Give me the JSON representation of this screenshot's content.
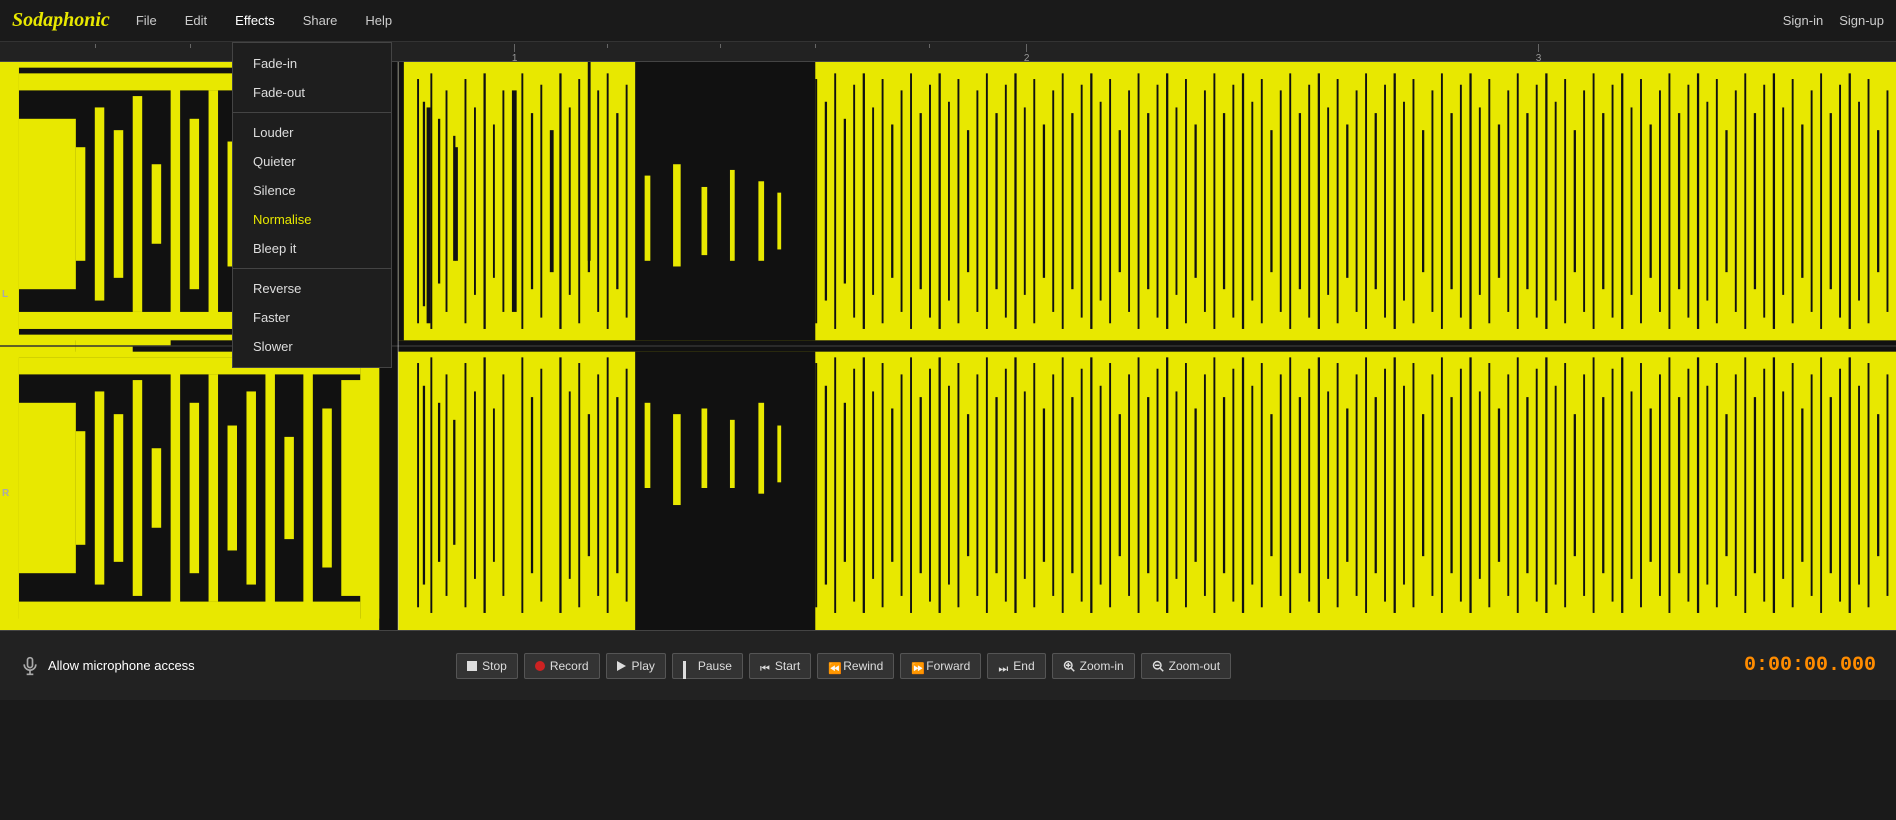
{
  "app": {
    "name": "Sodaphonic",
    "name_part1": "Soda",
    "name_part2": "phonic"
  },
  "nav": {
    "items": [
      {
        "id": "file",
        "label": "File"
      },
      {
        "id": "edit",
        "label": "Edit"
      },
      {
        "id": "effects",
        "label": "Effects"
      },
      {
        "id": "share",
        "label": "Share"
      },
      {
        "id": "help",
        "label": "Help"
      }
    ],
    "right_items": [
      {
        "id": "signin",
        "label": "Sign-in"
      },
      {
        "id": "signup",
        "label": "Sign-up"
      }
    ]
  },
  "effects_menu": {
    "items": [
      {
        "id": "fade-in",
        "label": "Fade-in",
        "highlighted": false,
        "divider_after": false
      },
      {
        "id": "fade-out",
        "label": "Fade-out",
        "highlighted": false,
        "divider_after": true
      },
      {
        "id": "louder",
        "label": "Louder",
        "highlighted": false,
        "divider_after": false
      },
      {
        "id": "quieter",
        "label": "Quieter",
        "highlighted": false,
        "divider_after": false
      },
      {
        "id": "silence",
        "label": "Silence",
        "highlighted": false,
        "divider_after": false
      },
      {
        "id": "normalise",
        "label": "Normalise",
        "highlighted": true,
        "divider_after": false
      },
      {
        "id": "bleep-it",
        "label": "Bleep it",
        "highlighted": false,
        "divider_after": true
      },
      {
        "id": "reverse",
        "label": "Reverse",
        "highlighted": false,
        "divider_after": false
      },
      {
        "id": "faster",
        "label": "Faster",
        "highlighted": false,
        "divider_after": false
      },
      {
        "id": "slower",
        "label": "Slower",
        "highlighted": false,
        "divider_after": false
      }
    ]
  },
  "waveform": {
    "channel_l_label": "L",
    "channel_r_label": "R",
    "timeline_marks": [
      {
        "position_pct": 27,
        "label": "1"
      },
      {
        "position_pct": 54,
        "label": "2"
      },
      {
        "position_pct": 81,
        "label": "3"
      }
    ]
  },
  "toolbar": {
    "mic_label": "Allow microphone access",
    "buttons": [
      {
        "id": "stop",
        "label": "Stop",
        "icon": "stop"
      },
      {
        "id": "record",
        "label": "Record",
        "icon": "record"
      },
      {
        "id": "play",
        "label": "Play",
        "icon": "play"
      },
      {
        "id": "pause",
        "label": "Pause",
        "icon": "pause"
      },
      {
        "id": "start",
        "label": "Start",
        "icon": "start"
      },
      {
        "id": "rewind",
        "label": "Rewind",
        "icon": "rewind"
      },
      {
        "id": "forward",
        "label": "Forward",
        "icon": "forward"
      },
      {
        "id": "end",
        "label": "End",
        "icon": "end"
      },
      {
        "id": "zoom-in",
        "label": "Zoom-in",
        "icon": "zoom-in"
      },
      {
        "id": "zoom-out",
        "label": "Zoom-out",
        "icon": "zoom-out"
      }
    ],
    "time_display": "0:00:00.000"
  },
  "colors": {
    "waveform_fill": "#e8e800",
    "waveform_bg": "#111111",
    "accent_orange": "#ff8c00",
    "record_red": "#cc2222",
    "highlight_yellow": "#e8e800"
  }
}
